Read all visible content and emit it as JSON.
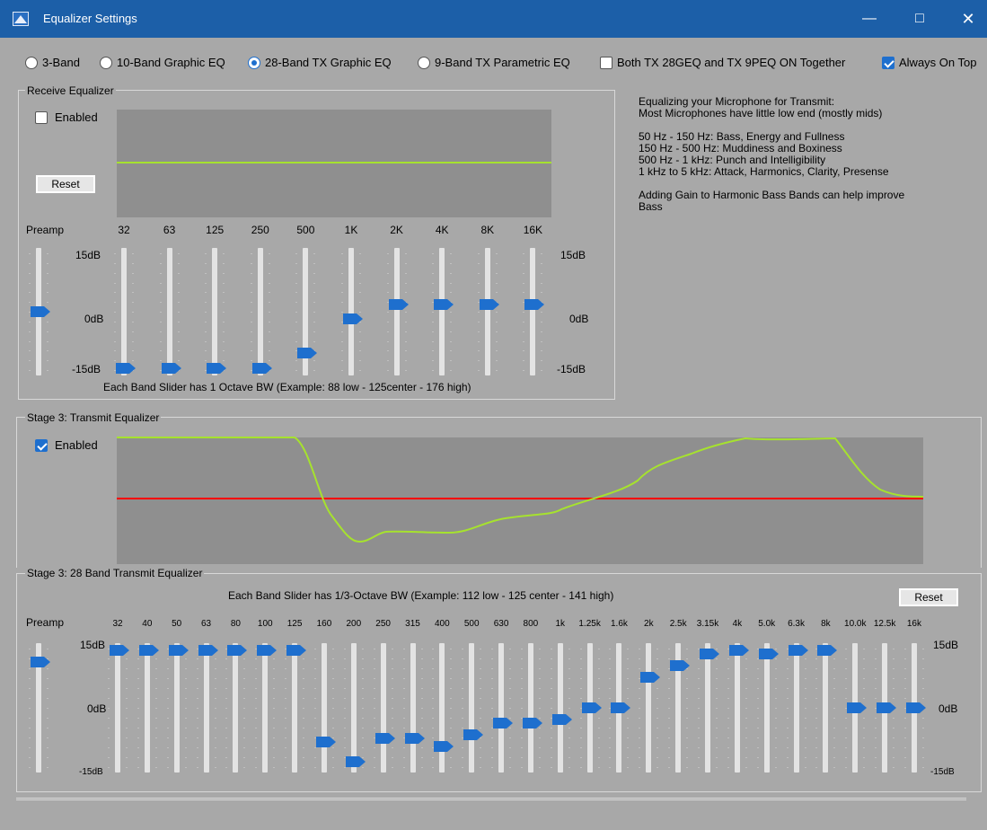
{
  "window": {
    "title": "Equalizer Settings",
    "minimize_icon": "minimize-icon",
    "maximize_icon": "maximize-icon",
    "close_icon": "close-icon",
    "titlebar_color": "#1c5fa8"
  },
  "options": [
    {
      "label": "3-Band",
      "type": "radio",
      "checked": false
    },
    {
      "label": "10-Band Graphic EQ",
      "type": "radio",
      "checked": false
    },
    {
      "label": "28-Band TX Graphic EQ",
      "type": "radio",
      "checked": true
    },
    {
      "label": "9-Band TX Parametric EQ",
      "type": "radio",
      "checked": false
    },
    {
      "label": "Both TX 28GEQ and TX 9PEQ ON Together",
      "type": "checkbox",
      "checked": false
    },
    {
      "label": "Always On Top",
      "type": "checkbox",
      "checked": true
    }
  ],
  "receive_eq": {
    "title": "Receive Equalizer",
    "enabled_label": "Enabled",
    "enabled": false,
    "reset_label": "Reset",
    "preamp_label": "Preamp",
    "preamp_db": 0,
    "bands": [
      {
        "label": "32",
        "db": -15
      },
      {
        "label": "63",
        "db": -15
      },
      {
        "label": "125",
        "db": -15
      },
      {
        "label": "250",
        "db": -15
      },
      {
        "label": "500",
        "db": -11
      },
      {
        "label": "1K",
        "db": -2
      },
      {
        "label": "2K",
        "db": 2
      },
      {
        "label": "4K",
        "db": 2
      },
      {
        "label": "8K",
        "db": 2
      },
      {
        "label": "16K",
        "db": 2
      }
    ],
    "scale_top": "15dB",
    "scale_mid": "0dB",
    "scale_bottom": "-15dB",
    "footnote": "Each Band Slider has 1 Octave BW (Example: 88 low - 125center  - 176 high)",
    "curve_color": "#a6e22e"
  },
  "info_text": {
    "lines_1": [
      "Equalizing your Microphone for Transmit:",
      "Most Microphones have little low end (mostly mids)"
    ],
    "lines_2": [
      "50 Hz - 150 Hz: Bass, Energy and Fullness",
      "150 Hz - 500 Hz: Muddiness and Boxiness",
      "500 Hz - 1 kHz: Punch and Intelligibility",
      "1 kHz to 5 kHz: Attack, Harmonics, Clarity, Presense"
    ],
    "lines_3": [
      "Adding Gain to Harmonic Bass Bands can help improve",
      "Bass"
    ]
  },
  "transmit_eq": {
    "title": "Stage 3: Transmit Equalizer",
    "enabled_label": "Enabled",
    "enabled": true,
    "curve_color": "#a6e22e",
    "zero_line_color": "#ff0000"
  },
  "band28": {
    "title": "Stage 3: 28 Band Transmit Equalizer",
    "footnote": "Each Band Slider has 1/3-Octave BW (Example: 112 low - 125 center  - 141 high)",
    "reset_label": "Reset",
    "preamp_label": "Preamp",
    "preamp_db": 12,
    "scale_top": "15dB",
    "scale_mid": "0dB",
    "scale_bottom": "-15dB",
    "bands": [
      {
        "label": "32",
        "db": 15
      },
      {
        "label": "40",
        "db": 15
      },
      {
        "label": "50",
        "db": 15
      },
      {
        "label": "63",
        "db": 15
      },
      {
        "label": "80",
        "db": 15
      },
      {
        "label": "100",
        "db": 15
      },
      {
        "label": "125",
        "db": 15
      },
      {
        "label": "160",
        "db": -9
      },
      {
        "label": "200",
        "db": -14
      },
      {
        "label": "250",
        "db": -8
      },
      {
        "label": "315",
        "db": -8
      },
      {
        "label": "400",
        "db": -10
      },
      {
        "label": "500",
        "db": -7
      },
      {
        "label": "630",
        "db": -4
      },
      {
        "label": "800",
        "db": -4
      },
      {
        "label": "1k",
        "db": -3
      },
      {
        "label": "1.25k",
        "db": 0
      },
      {
        "label": "1.6k",
        "db": 0
      },
      {
        "label": "2k",
        "db": 8
      },
      {
        "label": "2.5k",
        "db": 11
      },
      {
        "label": "3.15k",
        "db": 14
      },
      {
        "label": "4k",
        "db": 15
      },
      {
        "label": "5.0k",
        "db": 14
      },
      {
        "label": "6.3k",
        "db": 15
      },
      {
        "label": "8k",
        "db": 15
      },
      {
        "label": "10.0k",
        "db": 0
      },
      {
        "label": "12.5k",
        "db": 0
      },
      {
        "label": "16k",
        "db": 0
      }
    ]
  },
  "accent_color": "#1e6fce"
}
